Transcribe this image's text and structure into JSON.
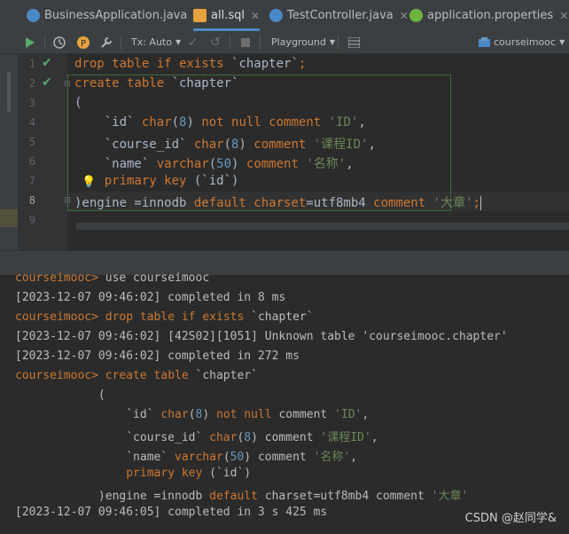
{
  "tabs": [
    {
      "label": "BusinessApplication.java",
      "icon": "java-class-icon",
      "color": "#4a88c7"
    },
    {
      "label": "all.sql",
      "icon": "sql-file-icon",
      "color": "#e6a23c"
    },
    {
      "label": "TestController.java",
      "icon": "java-class-icon",
      "color": "#4a88c7"
    },
    {
      "label": "application.properties",
      "icon": "spring-properties-icon",
      "color": "#6db33f"
    }
  ],
  "toolbar": {
    "tx_label": "Tx: Auto",
    "playground_label": "Playground",
    "datasource_label": "courseimooc"
  },
  "editor": {
    "line_numbers": [
      "1",
      "2",
      "3",
      "4",
      "5",
      "6",
      "7",
      "8",
      "9"
    ]
  },
  "console": {
    "prompt": "courseimooc>",
    "cmd1": "use courseimooc",
    "t1": "[2023-12-07 09:46:02] completed in 8 ms",
    "cmd2_kw": "drop table",
    "cmd2_if": "if",
    "cmd2_exists": "exists",
    "cmd2_ident": "`chapter`",
    "t2": "[2023-12-07 09:46:02] [42S02][1051] Unknown table 'courseimooc.chapter'",
    "t3": "[2023-12-07 09:46:02] completed in 272 ms",
    "cmd3_kw": "create table",
    "cmd3_ident": "`chapter`",
    "t4": "[2023-12-07 09:46:05] completed in 3 s 425 ms"
  },
  "watermark": "CSDN @赵同学&"
}
